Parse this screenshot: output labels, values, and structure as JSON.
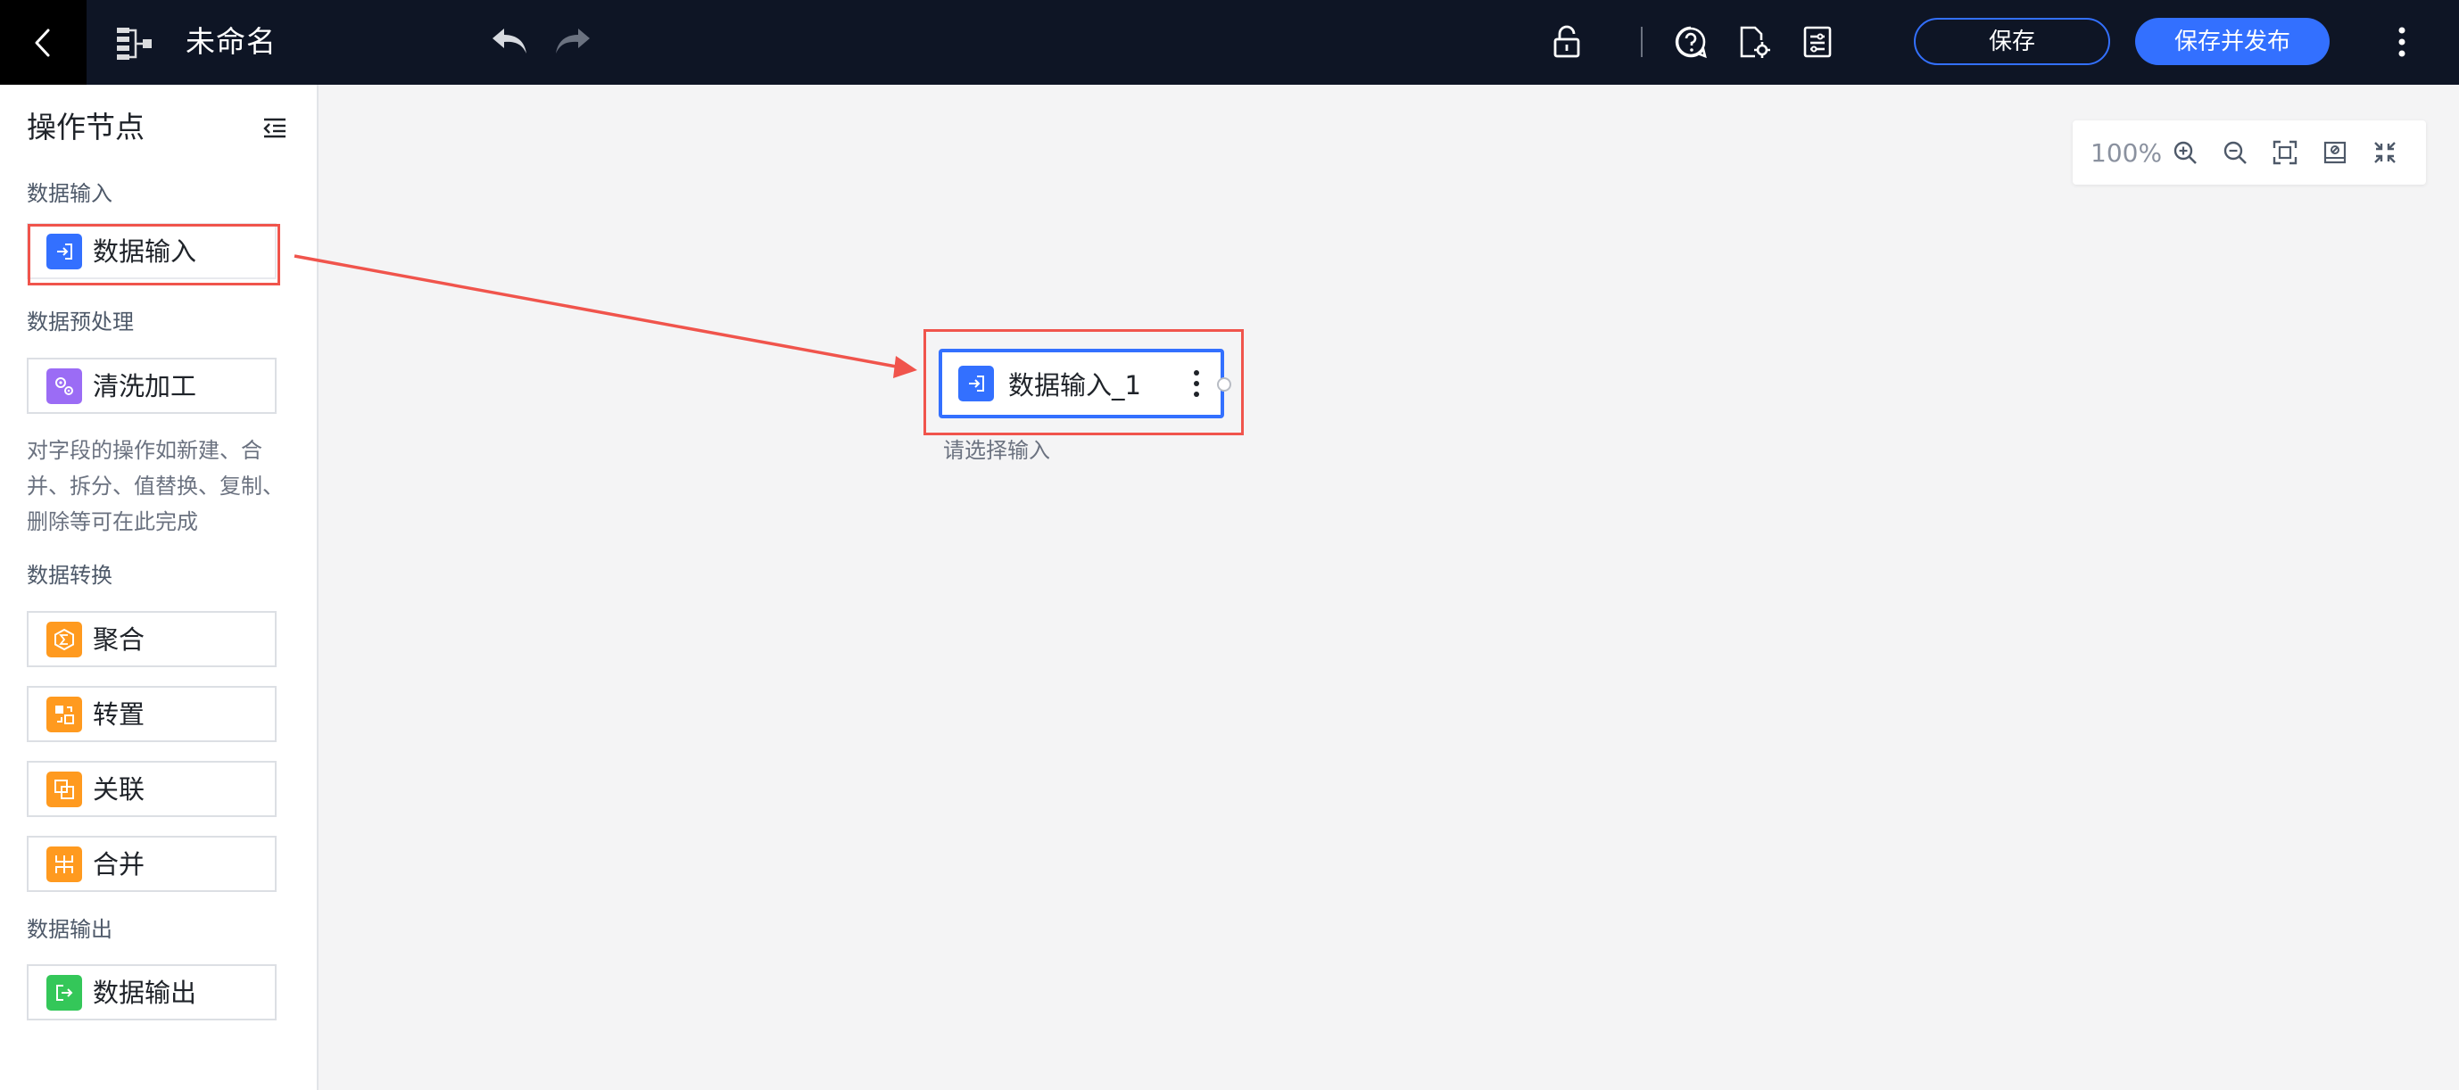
{
  "header": {
    "title": "未命名",
    "save_label": "保存",
    "publish_label": "保存并发布",
    "icons": {
      "back": "chevron-left-icon",
      "flow": "workflow-icon",
      "undo": "undo-icon",
      "redo": "redo-icon",
      "lock": "lock-icon",
      "help": "help-icon",
      "doc_settings": "document-settings-icon",
      "variables": "variables-icon",
      "more": "more-vertical-icon"
    }
  },
  "sidebar": {
    "title": "操作节点",
    "sections": {
      "input": {
        "title": "数据输入",
        "items": [
          {
            "label": "数据输入",
            "icon": "data-input-icon",
            "color": "#3370ff"
          }
        ]
      },
      "preprocess": {
        "title": "数据预处理",
        "items": [
          {
            "label": "清洗加工",
            "icon": "clean-process-icon",
            "color": "#9b6cf5"
          }
        ],
        "description": "对字段的操作如新建、合并、拆分、值替换、复制、删除等可在此完成"
      },
      "transform": {
        "title": "数据转换",
        "items": [
          {
            "label": "聚合",
            "icon": "aggregate-icon",
            "color": "#ff9a1f"
          },
          {
            "label": "转置",
            "icon": "transpose-icon",
            "color": "#ff9a1f"
          },
          {
            "label": "关联",
            "icon": "join-icon",
            "color": "#ff9a1f"
          },
          {
            "label": "合并",
            "icon": "union-icon",
            "color": "#ff9a1f"
          }
        ]
      },
      "output": {
        "title": "数据输出",
        "items": [
          {
            "label": "数据输出",
            "icon": "data-output-icon",
            "color": "#34c759"
          }
        ]
      }
    }
  },
  "canvas": {
    "zoom_level": "100%",
    "zoom_tools": [
      "zoom-in-icon",
      "zoom-out-icon",
      "fit-screen-icon",
      "minimap-icon",
      "fullscreen-icon"
    ],
    "node": {
      "label": "数据输入_1",
      "hint": "请选择输入",
      "color": "#3370ff"
    }
  },
  "colors": {
    "accent": "#3370ff",
    "annotation": "#f0544c",
    "header_bg": "#0e1525"
  }
}
